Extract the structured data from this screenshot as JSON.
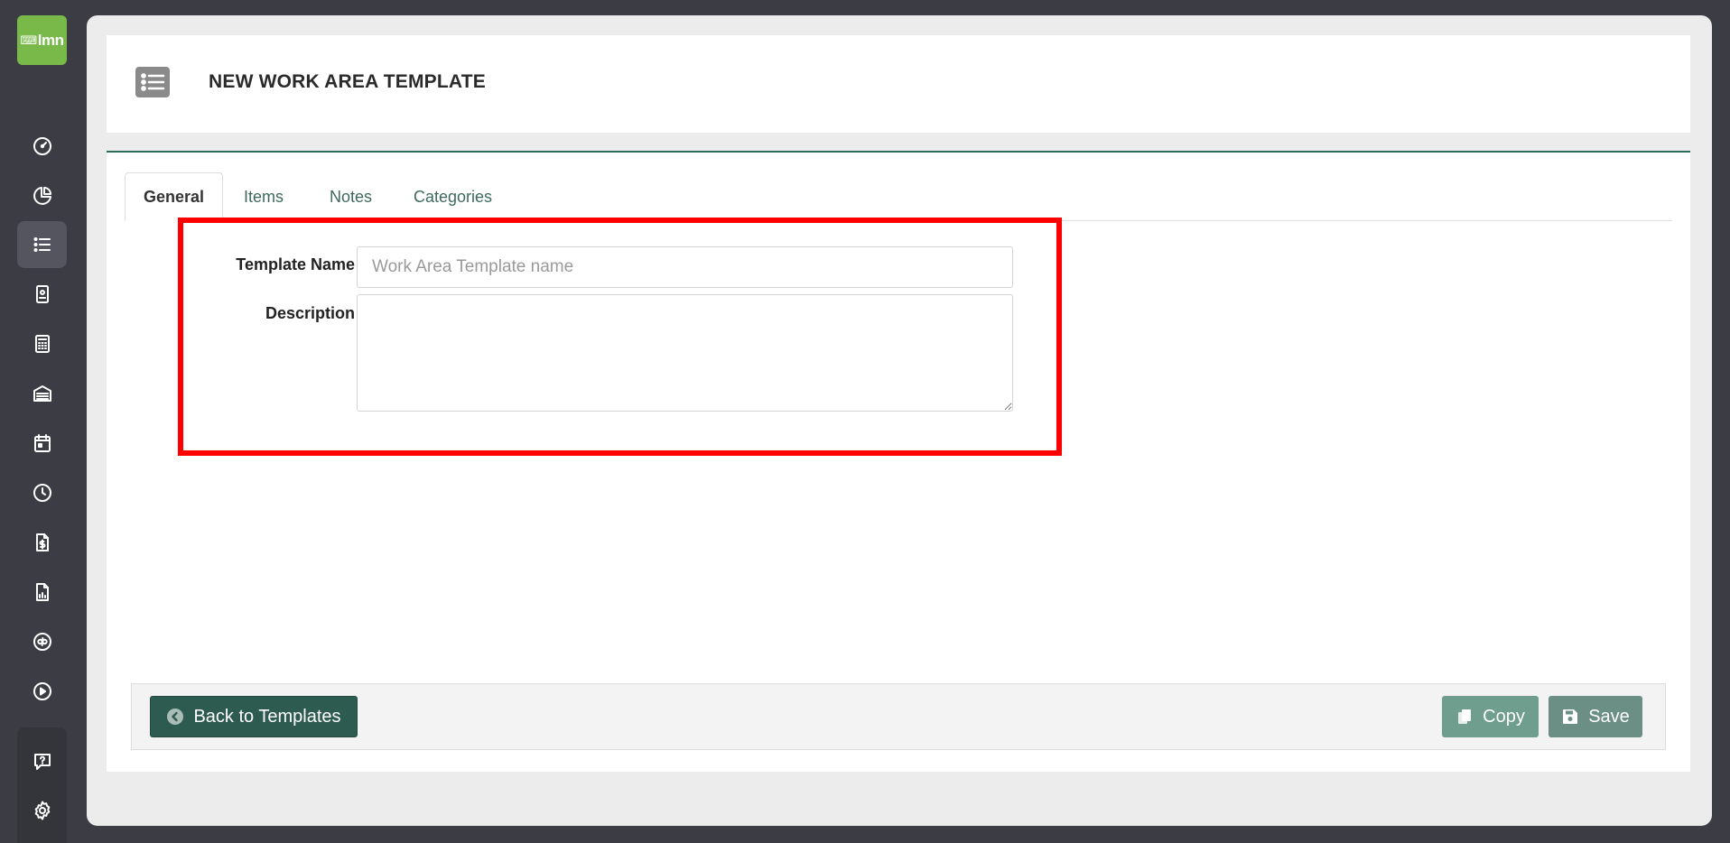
{
  "app": {
    "logo_text": "lmn",
    "brand_color": "#78b94a"
  },
  "sidebar": {
    "items": [
      {
        "icon": "dashboard-gauge-icon",
        "active": false
      },
      {
        "icon": "pie-chart-icon",
        "active": false
      },
      {
        "icon": "list-icon",
        "active": true
      },
      {
        "icon": "contact-card-icon",
        "active": false
      },
      {
        "icon": "calculator-icon",
        "active": false
      },
      {
        "icon": "garage-icon",
        "active": false
      },
      {
        "icon": "calendar-icon",
        "active": false
      },
      {
        "icon": "clock-icon",
        "active": false
      },
      {
        "icon": "invoice-dollar-icon",
        "active": false
      },
      {
        "icon": "report-chart-icon",
        "active": false
      },
      {
        "icon": "quickbooks-icon",
        "active": false
      },
      {
        "icon": "play-circle-icon",
        "active": false
      }
    ],
    "bottom_items": [
      {
        "icon": "help-chat-icon"
      },
      {
        "icon": "settings-gear-icon"
      }
    ]
  },
  "header": {
    "title": "NEW WORK AREA TEMPLATE",
    "icon": "list-icon"
  },
  "tabs": [
    {
      "label": "General",
      "active": true
    },
    {
      "label": "Items",
      "active": false
    },
    {
      "label": "Notes",
      "active": false
    },
    {
      "label": "Categories",
      "active": false
    }
  ],
  "form": {
    "template_name_label": "Template Name",
    "template_name_placeholder": "Work Area Template name",
    "template_name_value": "",
    "description_label": "Description",
    "description_value": ""
  },
  "footer": {
    "back_label": "Back to Templates",
    "copy_label": "Copy",
    "save_label": "Save"
  },
  "colors": {
    "accent": "#2e5b4f",
    "highlight": "#ff0000"
  }
}
